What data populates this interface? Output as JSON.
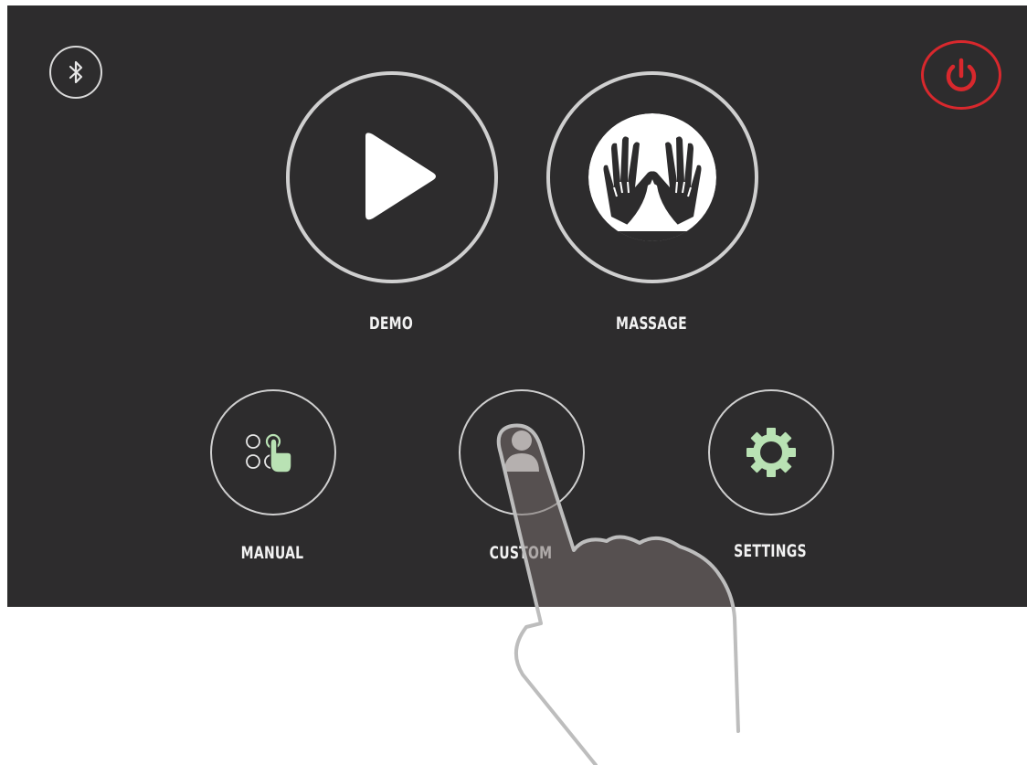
{
  "header": {
    "bluetooth_icon": "bluetooth-icon",
    "power_icon": "power-icon",
    "power_color": "#d8282d"
  },
  "main_menu": {
    "demo": {
      "label": "DEMO",
      "icon": "play-icon"
    },
    "massage": {
      "label": "MASSAGE",
      "icon": "massage-hands-icon"
    },
    "manual": {
      "label": "MANUAL",
      "icon": "touch-grid-icon"
    },
    "custom": {
      "label": "CUSTOM",
      "icon": "user-icon"
    },
    "settings": {
      "label": "SETTINGS",
      "icon": "gear-icon"
    }
  },
  "colors": {
    "screen_background": "#2d2c2d",
    "accent_green": "#b9e2b4",
    "ring": "#cfcfcf"
  },
  "overlay": {
    "icon": "pointing-hand-overlay"
  }
}
